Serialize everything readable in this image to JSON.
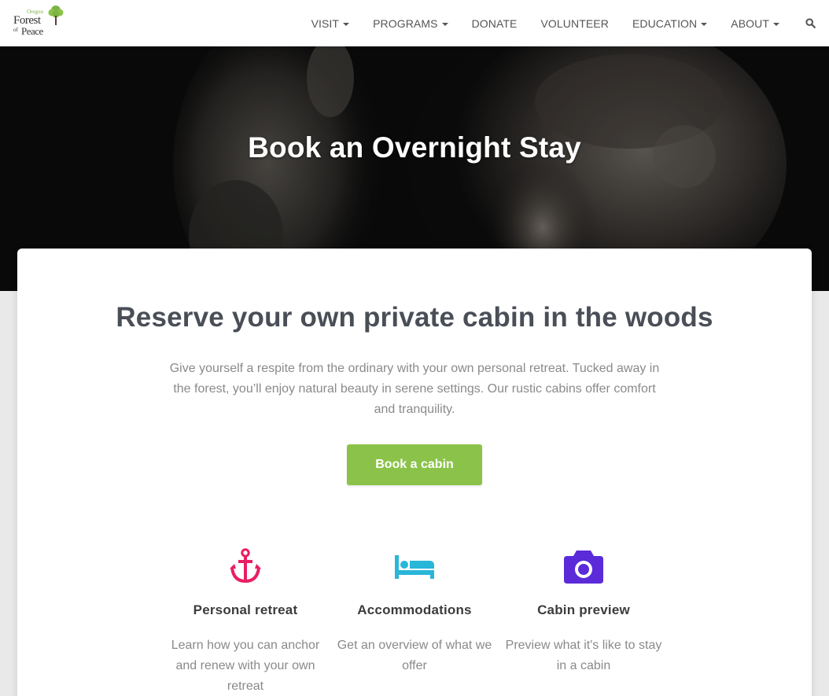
{
  "logo": {
    "small_text": "Oregon",
    "line1": "Forest",
    "line2_prefix": "of",
    "line2": "Peace"
  },
  "nav": {
    "items": [
      {
        "label": "VISIT",
        "dropdown": true
      },
      {
        "label": "PROGRAMS",
        "dropdown": true
      },
      {
        "label": "DONATE",
        "dropdown": false
      },
      {
        "label": "VOLUNTEER",
        "dropdown": false
      },
      {
        "label": "EDUCATION",
        "dropdown": true
      },
      {
        "label": "ABOUT",
        "dropdown": true
      }
    ],
    "search_icon": "search-icon"
  },
  "hero": {
    "title": "Book an Overnight Stay"
  },
  "main": {
    "heading": "Reserve your own private cabin in the woods",
    "text": "Give yourself a respite from the ordinary with your own personal retreat. Tucked away in the forest, you’ll enjoy natural beauty in serene settings. Our rustic cabins offer comfort and tranquility.",
    "button_label": "Book a cabin"
  },
  "features": [
    {
      "icon": "anchor-icon",
      "color": "#e91e63",
      "title": "Personal retreat",
      "desc": "Learn how you can anchor and renew with your own retreat"
    },
    {
      "icon": "bed-icon",
      "color": "#29b6d8",
      "title": "Accommodations",
      "desc": "Get an overview of what we offer"
    },
    {
      "icon": "camera-icon",
      "color": "#5b2bd9",
      "title": "Cabin preview",
      "desc": "Preview what it's like to stay in a cabin"
    }
  ],
  "colors": {
    "accent_green": "#8bc34a",
    "heading": "#4a4e57",
    "body_text": "#8a8a8a"
  }
}
